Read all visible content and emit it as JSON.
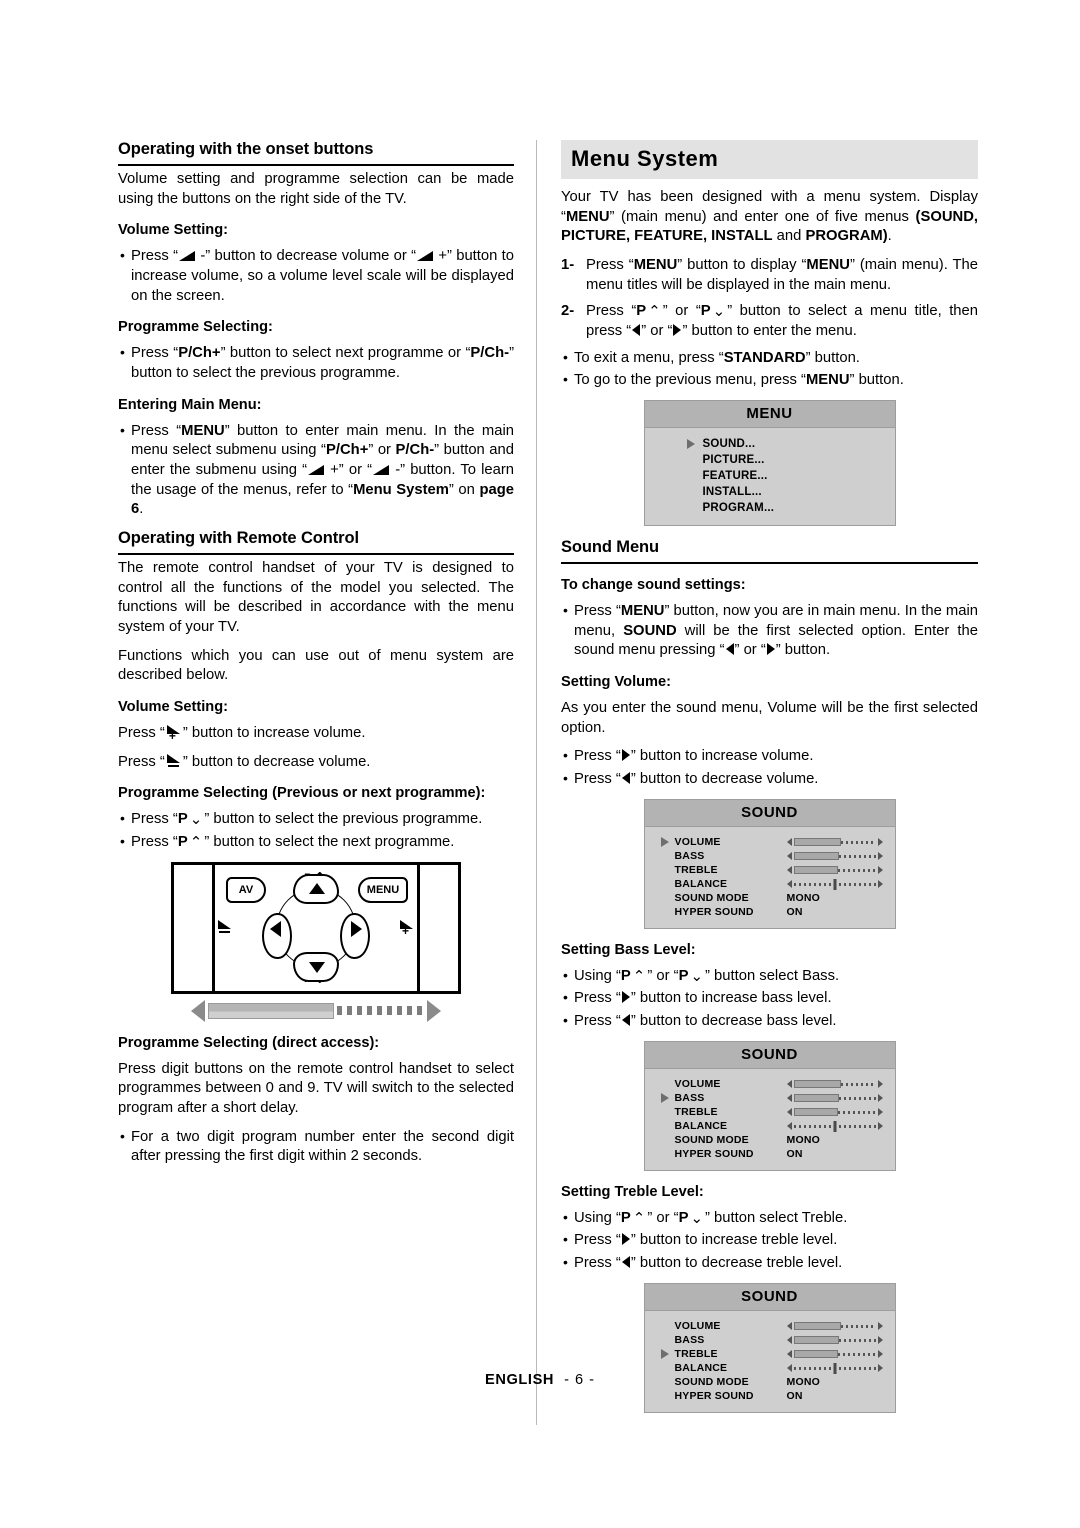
{
  "left_column": {
    "heading_onset": "Operating with the onset buttons",
    "intro": "Volume setting and programme selection can be made using the buttons on the right side of the TV.",
    "volume_setting_head": "Volume Setting:",
    "volume_bullet_a": "Press “",
    "volume_bullet_b": " -” button to decrease volume or “",
    "volume_bullet_c": " +” button to increase volume, so a volume level scale will be displayed on the screen.",
    "programme_selecting_head": "Programme Selecting:",
    "programme_bullet_a": "Press “",
    "programme_bullet_pch_plus": "P/Ch+",
    "programme_bullet_b": "” button to select next programme or “",
    "programme_bullet_pch_minus": "P/Ch-",
    "programme_bullet_c": "” button to select the previous programme.",
    "entering_main_menu_head": "Entering Main Menu:",
    "entering_a": "Press “",
    "entering_menu": "MENU",
    "entering_b": "” button to enter main menu. In the main menu select submenu using “",
    "entering_pch_plus": "P/Ch+",
    "entering_c": "” or ",
    "entering_pch_minus": "P/Ch-",
    "entering_d": "” button and enter the submenu using “",
    "entering_e": " +” or “",
    "entering_f": " -” button. To learn the usage of the menus, refer to “",
    "entering_menu_system": "Menu System",
    "entering_g": "” on ",
    "entering_page": "page 6",
    "entering_h": ".",
    "heading_remote": "Operating with Remote Control",
    "remote_para1": "The remote control handset of your TV is designed to control all the functions of the model you selected. The functions will be described  in accordance with the menu system of your TV.",
    "remote_para2": "Functions which you can use out of menu system are described below.",
    "remote_volume_head": "Volume Setting:",
    "remote_vol_inc_a": "Press “",
    "remote_vol_inc_b": "” button to increase volume.",
    "remote_vol_dec_a": "Press “",
    "remote_vol_dec_b": "”  button  to decrease volume.",
    "prog_prev_next_head": "Programme Selecting  (Previous or next programme):",
    "prog_prev_a": "Press “",
    "prog_prev_p": "P",
    "prog_prev_b": "” button to select the previous programme.",
    "prog_next_a": "Press “",
    "prog_next_p": "P",
    "prog_next_b": "” button to select the next programme.",
    "remote_diagram": {
      "av_label": "AV",
      "menu_label": "MENU",
      "p_up_label": "P",
      "p_down_label": "P",
      "vol_down_icon": "volume-down-icon",
      "vol_up_icon": "volume-up-icon"
    },
    "direct_access_head": "Programme Selecting (direct access):",
    "direct_access_para": "Press digit buttons on the remote control handset to select programmes between 0 and 9. TV will switch to the selected program after a short delay.",
    "direct_access_bullet": "For a two digit program number enter the second digit after pressing the first digit within 2 seconds."
  },
  "right_column": {
    "banner_title": "Menu System",
    "intro_a": "Your TV has been designed with a menu system. Display “",
    "intro_menu": "MENU",
    "intro_b": "” (main menu) and enter one of five menus ",
    "intro_menus_bold": "(SOUND, PICTURE, FEATURE, INSTALL",
    "intro_and": " and ",
    "intro_program_bold": "PROGRAM)",
    "intro_c": ".",
    "step1_num": "1-",
    "step1_a": "Press “",
    "step1_menu1": "MENU",
    "step1_b": "” button to display “",
    "step1_menu2": "MENU",
    "step1_c": "” (main menu). The menu titles will be displayed in the main menu.",
    "step2_num": "2-",
    "step2_a": "Press “",
    "step2_p1": "P",
    "step2_b": "” or “",
    "step2_p2": "P",
    "step2_c": "” button to select a menu title, then press “",
    "step2_d": "” or “",
    "step2_e": "” button to enter the menu.",
    "bullet_exit_a": "To exit a menu, press “",
    "bullet_exit_standard": "STANDARD",
    "bullet_exit_b": "” button.",
    "bullet_prev_a": "To go to the previous menu, press “",
    "bullet_prev_menu": "MENU",
    "bullet_prev_b": "” button.",
    "menu_osd": {
      "title": "MENU",
      "items": [
        {
          "label": "SOUND...",
          "selected": true
        },
        {
          "label": "PICTURE...",
          "selected": false
        },
        {
          "label": "FEATURE...",
          "selected": false
        },
        {
          "label": "INSTALL...",
          "selected": false
        },
        {
          "label": "PROGRAM...",
          "selected": false
        }
      ]
    },
    "heading_sound_menu": "Sound Menu",
    "change_sound_head": "To change sound settings:",
    "change_sound_a": "Press “",
    "change_sound_menu": "MENU",
    "change_sound_b": "” button,  now you are in main menu. In the main menu, ",
    "change_sound_sound": "SOUND",
    "change_sound_c": " will be the first selected option. Enter the sound menu pressing “",
    "change_sound_d": "” or “",
    "change_sound_e": "” button.",
    "setting_volume_head": "Setting Volume:",
    "setting_volume_para": "As you enter the sound menu, Volume will be the first selected option.",
    "vol_inc_a": "Press “",
    "vol_inc_b": "” button to increase volume.",
    "vol_dec_a": "Press “",
    "vol_dec_b": "” button to decrease volume.",
    "setting_bass_head": "Setting Bass Level:",
    "bass_using_a": "Using “",
    "bass_using_p1": "P",
    "bass_using_b": "” or “",
    "bass_using_p2": "P",
    "bass_using_c": "” button select Bass.",
    "bass_inc_a": "Press “",
    "bass_inc_b": "” button to increase bass level.",
    "bass_dec_a": "Press “",
    "bass_dec_b": "” button to decrease bass level.",
    "setting_treble_head": "Setting Treble Level:",
    "treble_using_a": "Using “",
    "treble_using_p1": "P",
    "treble_using_b": "” or “",
    "treble_using_p2": "P",
    "treble_using_c": "” button select Treble.",
    "treble_inc_a": "Press “",
    "treble_inc_b": "” button to increase treble level.",
    "treble_dec_a": "Press “",
    "treble_dec_b": "” button to decrease treble level.",
    "sound_osd_title": "SOUND",
    "sound_osd_rows": {
      "volume": "VOLUME",
      "bass": "BASS",
      "treble": "TREBLE",
      "balance": "BALANCE",
      "sound_mode": "SOUND MODE",
      "hyper_sound": "HYPER SOUND",
      "sound_mode_value": "MONO",
      "hyper_sound_value": "ON"
    },
    "sound_osd_levels": {
      "volume_pct": 58,
      "bass_pct": 56,
      "treble_pct": 54,
      "balance_pct": 50
    },
    "sound_osd_selected": [
      "VOLUME",
      "BASS",
      "TREBLE"
    ]
  },
  "footer": {
    "language": "ENGLISH",
    "page": "- 6 -"
  },
  "colors": {
    "banner_bg": "#e2e2e2",
    "osd_bg": "#cfcfcf",
    "osd_title_bg": "#b3b3b3",
    "text": "#000000",
    "divider": "#b9b9b9"
  }
}
